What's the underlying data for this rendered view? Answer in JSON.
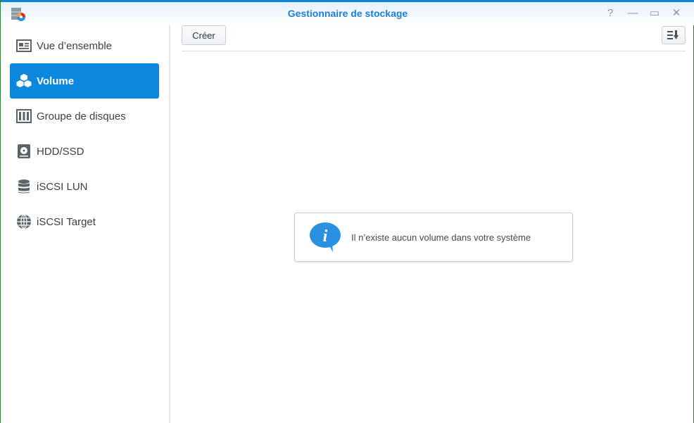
{
  "window": {
    "title": "Gestionnaire de stockage",
    "help": "?",
    "minimize": "—",
    "maximize": "▭",
    "close": "✕"
  },
  "sidebar": {
    "items": [
      {
        "label": "Vue d’ensemble",
        "icon": "overview-icon"
      },
      {
        "label": "Volume",
        "icon": "cubes-icon",
        "active": true
      },
      {
        "label": "Groupe de disques",
        "icon": "disk-group-icon"
      },
      {
        "label": "HDD/SSD",
        "icon": "hdd-icon"
      },
      {
        "label": "iSCSI LUN",
        "icon": "database-icon"
      },
      {
        "label": "iSCSI Target",
        "icon": "globe-icon"
      }
    ]
  },
  "toolbar": {
    "create_label": "Créer",
    "sort_icon": "sort-icon"
  },
  "main": {
    "empty_message": "Il n’existe aucun volume dans votre système"
  },
  "colors": {
    "accent": "#0b87dd",
    "title": "#1a7fd6"
  }
}
